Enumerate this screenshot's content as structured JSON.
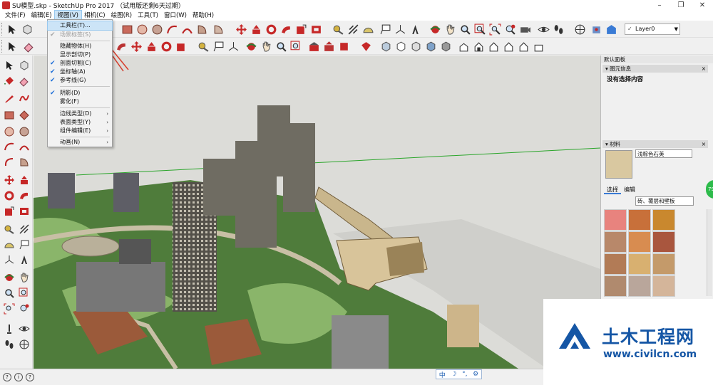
{
  "window": {
    "title": "SU模型.skp - SketchUp Pro 2017 （试用版还剩6天过期）",
    "controls": [
      "–",
      "❐",
      "✕"
    ]
  },
  "menubar": [
    {
      "label": "文件(F)"
    },
    {
      "label": "编辑(E)"
    },
    {
      "label": "视图(V)",
      "active": true
    },
    {
      "label": "相机(C)"
    },
    {
      "label": "绘图(R)"
    },
    {
      "label": "工具(T)"
    },
    {
      "label": "窗口(W)"
    },
    {
      "label": "帮助(H)"
    }
  ],
  "layer_selector": {
    "value": "Layer0",
    "check": "✓",
    "arrow": "▼"
  },
  "view_menu": {
    "items": [
      {
        "label": "工具栏(T)...",
        "highlighted": true
      },
      {
        "label": "场景标签(S)",
        "checked": true,
        "disabled": true
      },
      {
        "separator": true
      },
      {
        "label": "隐藏物体(H)"
      },
      {
        "label": "显示剖切(P)"
      },
      {
        "label": "剖面切割(C)",
        "checked": true
      },
      {
        "label": "坐标轴(A)",
        "checked": true
      },
      {
        "label": "参考线(G)",
        "checked": true
      },
      {
        "separator": true
      },
      {
        "label": "阴影(D)",
        "checked": true
      },
      {
        "label": "雾化(F)"
      },
      {
        "separator": true
      },
      {
        "label": "边线类型(D)",
        "submenu": true
      },
      {
        "label": "表面类型(Y)",
        "submenu": true
      },
      {
        "label": "组件编辑(E)",
        "submenu": true
      },
      {
        "separator": true
      },
      {
        "label": "动画(N)",
        "submenu": true
      }
    ],
    "check_glyph": "✔",
    "submenu_glyph": "›"
  },
  "tray": {
    "title": "默认面板",
    "entity_info": {
      "header": "图元信息",
      "text": "没有选择内容",
      "close": "×"
    },
    "materials": {
      "header": "材料",
      "close": "×",
      "current_name": "浅粽色石英",
      "tabs": [
        "选择",
        "编辑"
      ],
      "category": "砖、覆层和壁板",
      "swatch_colors": [
        "#e8837e",
        "#c8703a",
        "#c9882e",
        "#b8886a",
        "#d88c50",
        "#a9563e",
        "#b27b56",
        "#d8b070",
        "#c49a6a",
        "#b08a6e",
        "#b9a69b",
        "#d4b59a"
      ]
    },
    "badge": "79"
  },
  "statusbar": {
    "icons": [
      "?",
      "i",
      "?"
    ],
    "ime": [
      "中",
      "☽",
      "°,",
      "⚙"
    ]
  },
  "watermark": {
    "name": "土木工程网",
    "url": "www.civilcn.com"
  },
  "colors": {
    "accent": "#3a7bd5",
    "menu_highlight": "#cce4f7",
    "ground_green": "#4f7c3b",
    "sky": "#dcdcd8",
    "watermark_blue": "#1556a5"
  }
}
